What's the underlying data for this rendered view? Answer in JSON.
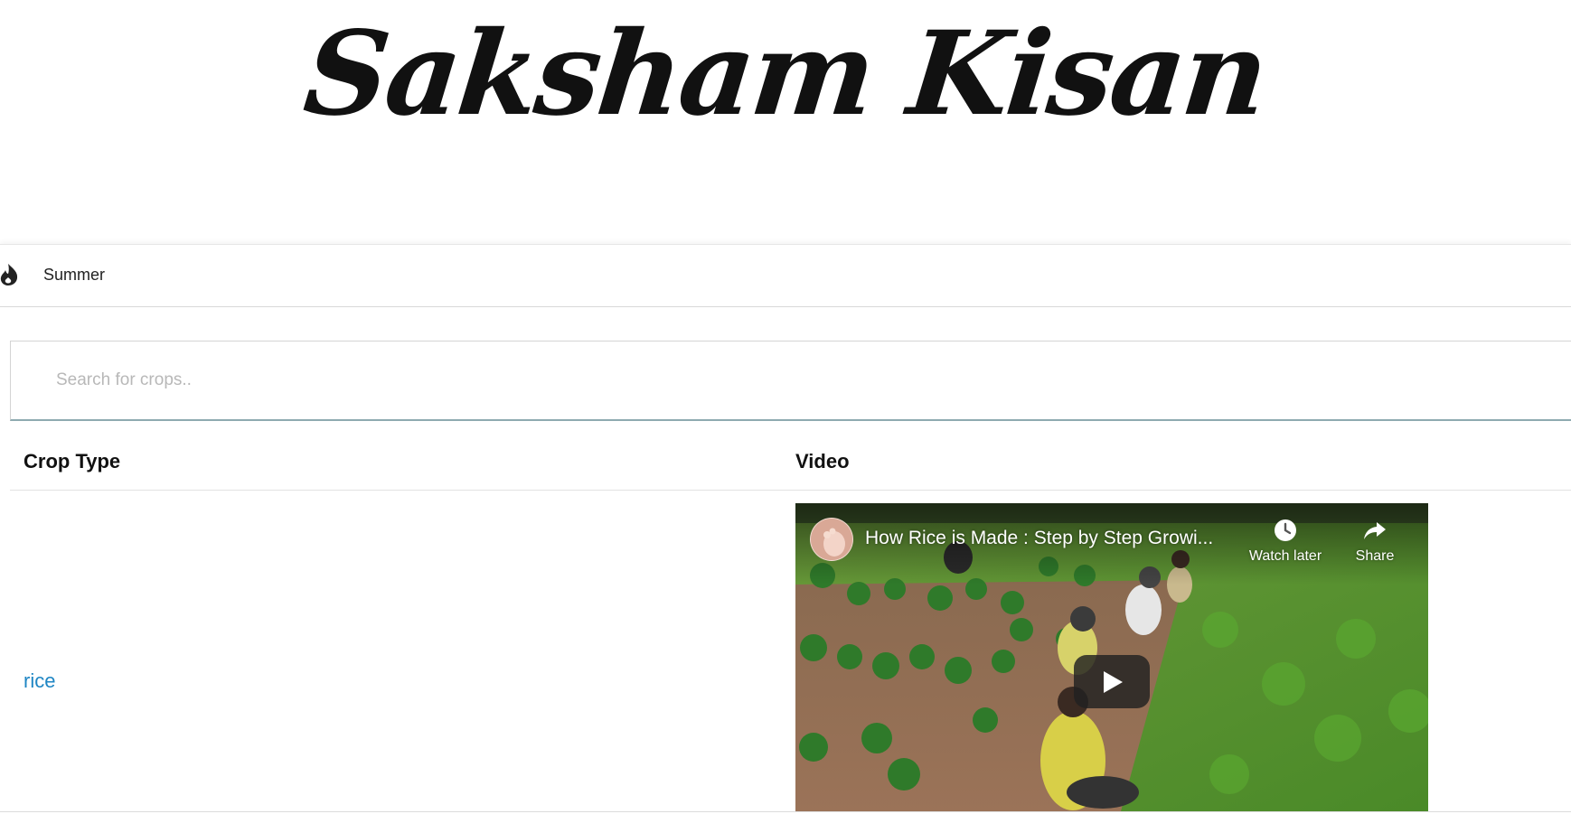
{
  "header": {
    "logo_text": "Saksham Kisan"
  },
  "season": {
    "label": "Summer",
    "icon": "flame-icon"
  },
  "search": {
    "placeholder": "Search for crops.."
  },
  "table": {
    "columns": [
      "Crop Type",
      "Video"
    ],
    "rows": [
      {
        "crop": "rice",
        "video": {
          "title": "How Rice is Made : Step by Step Growi...",
          "watch_later_label": "Watch later",
          "share_label": "Share"
        }
      }
    ]
  },
  "colors": {
    "link": "#1f86c4",
    "search_underline": "#8eaab0",
    "text": "#111111"
  }
}
